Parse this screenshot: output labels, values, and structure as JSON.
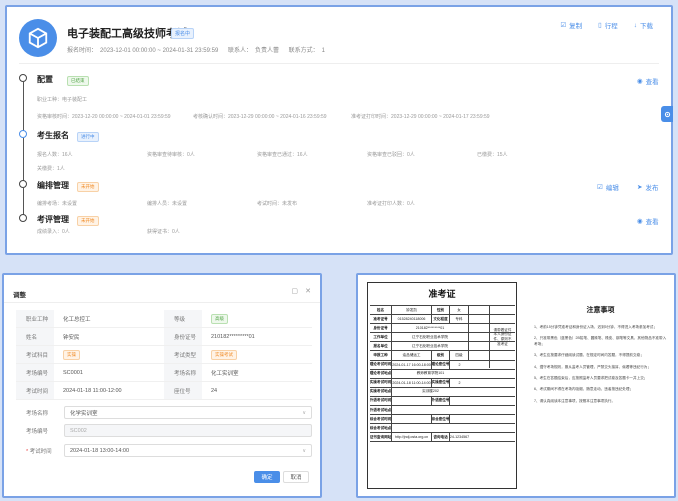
{
  "exam": {
    "title": "电子装配工高级技师考试",
    "status": "报名中",
    "time_label": "报名时间：",
    "time_value": "2023-12-01 00:00:00 ~ 2024-01-31 23:59:59",
    "contact_label": "联系人：",
    "contact_value": "负责人蕾",
    "phone_label": "联系方式：",
    "phone_value": "1"
  },
  "top_actions": {
    "copy": "复制",
    "itinerary": "行程",
    "download": "下载"
  },
  "steps": [
    {
      "title": "配置",
      "badge": "已结束",
      "info": [
        "职业工种：电子装配工"
      ],
      "info2": [
        "资格审核时间：2023-12-20 00:00:00 ~ 2024-01-01 23:59:59",
        "考核确认时间：2023-12-29 00:00:00 ~ 2024-01-16 23:59:59",
        "准考证打印时间：2023-12-29 00:00:00 ~ 2024-01-17 23:59:59"
      ],
      "link": "查看"
    },
    {
      "title": "考生报名",
      "badge": "进行中",
      "info": [
        "报名人数：16人",
        "资格审查待审核：0人",
        "资格审查已通过：16人",
        "资格审查已驳回：0人",
        "已缴费：15人"
      ],
      "info2": [
        "关缴费：1人"
      ],
      "link": ""
    },
    {
      "title": "编排管理",
      "badge": "未开始",
      "info": [
        "编排考场：未设置",
        "编排人员：未设置",
        "考试时间：未发布",
        "准考证打印人数：0人"
      ],
      "link_edit": "编辑",
      "link_publish": "发布"
    },
    {
      "title": "考评管理",
      "badge": "未开始",
      "info": [
        "成绩录入：0人",
        "获得证书：0人"
      ],
      "link": "查看"
    }
  ],
  "dialog": {
    "title": "调整",
    "rows": [
      [
        {
          "label": "职业工种",
          "value": "化工总控工"
        },
        {
          "label": "等级",
          "value": "高级",
          "tag": "green"
        }
      ],
      [
        {
          "label": "姓名",
          "value": "钟安民"
        },
        {
          "label": "身份证号",
          "value": "210182*********01"
        }
      ],
      [
        {
          "label": "考试科目",
          "value": "实操",
          "tag": "orange"
        },
        {
          "label": "考试类型",
          "value": "实操考试",
          "tag": "orange"
        }
      ],
      [
        {
          "label": "考场编号",
          "value": "SC0001"
        },
        {
          "label": "考场名称",
          "value": "化工实训室"
        }
      ],
      [
        {
          "label": "考试时间",
          "value": "2024-01-18 11:00-12:00"
        },
        {
          "label": "座位号",
          "value": "24"
        }
      ]
    ],
    "form": {
      "room_label": "考场名称",
      "room_value": "化学实训室",
      "code_label": "考场编号",
      "code_value": "SC002",
      "time_label": "考试时间",
      "time_value": "2024-01-18 13:00-14:00"
    },
    "ok": "确定",
    "cancel": "取消"
  },
  "ticket": {
    "title": "准考证",
    "photo_text": "请带着证件本人身份证件、原则不准考证",
    "rows": [
      [
        "姓名",
        "钟发凯",
        "性别",
        "女"
      ],
      [
        "准考证号",
        "01528240118006",
        "文化程度",
        "专科"
      ],
      [
        "身份证号",
        "210182*********01",
        "",
        ""
      ],
      [
        "工作单位",
        "辽宁石化职业技术学院",
        "",
        ""
      ],
      [
        "报名单位",
        "辽宁石化职业技术学院",
        "",
        ""
      ],
      [
        "申报工种",
        "油品储运工",
        "级别",
        "四级"
      ],
      [
        "理论考试时间",
        "2024-01-17 16:00-18:00",
        "理论座位号",
        "2"
      ],
      [
        "理论考试地点",
        "教师教育学院101",
        "",
        ""
      ],
      [
        "实操考试时间",
        "2024-01-18 11:00-14:00",
        "实操座位号",
        "2"
      ],
      [
        "实操考试地点",
        "实训楼202",
        "",
        ""
      ],
      [
        "外语考试时间",
        "",
        "外语座位号",
        ""
      ],
      [
        "外语考试地点",
        "",
        "",
        ""
      ],
      [
        "综合考试时间",
        "",
        "综合座位号",
        ""
      ],
      [
        "综合考试地点",
        "",
        "",
        ""
      ],
      [
        "证书查询网站",
        "http://jndj.osta.org.cn",
        "咨询电话",
        "024-12345678"
      ]
    ],
    "notice_title": "注意事项",
    "notices": [
      "1、考前15分钟凭准考证和身份证入场，迟到5分钟，不得进入考场参加考试；",
      "2、只准带黑色（蓝黑色）2B铅笔、圆珠笔、橡皮、钢笔等文具，其他物品不准带入考场；",
      "3、考生应按要求仔细阅读试题，在规定时间内答题，不得提前交卷；",
      "4、遵守考场规则，服从监考人员管理，严禁交头接耳、偷看等违纪行为；",
      "5、考生在答题结束后，应按照监考人员要求把试卷及答题卡一并上交；",
      "6、考试期间不得在考场内吸烟、随意走动，违者按违纪处理；",
      "7、请认真阅读本注意事项，按照本注意事项执行。"
    ]
  }
}
